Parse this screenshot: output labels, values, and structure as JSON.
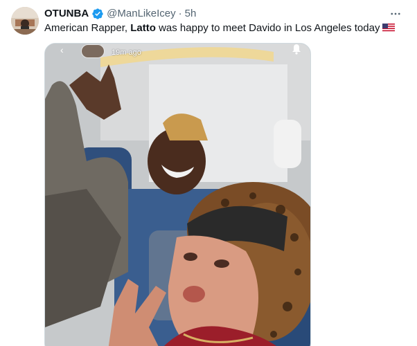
{
  "tweet": {
    "author_name": "OTUNBA",
    "handle": "@ManLikeIcey",
    "separator": "·",
    "time": "5h",
    "text_before": "American Rapper, ",
    "text_bold": "Latto",
    "text_after": " was happy to meet Davido in Los Angeles today",
    "flag_icon": "us-flag-icon",
    "verified_color": "#1d9bf0"
  },
  "media": {
    "story_time": "19m ago",
    "description_icon": "selfie-photo"
  },
  "colors": {
    "text": "#0f1419",
    "muted": "#536471",
    "border": "#cfd9de"
  }
}
